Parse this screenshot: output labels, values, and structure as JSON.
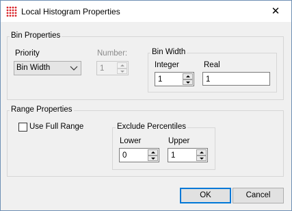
{
  "window": {
    "title": "Local Histogram Properties",
    "app_icon": "grid-dots-icon",
    "close_glyph": "✕"
  },
  "bin_properties": {
    "legend": "Bin Properties",
    "priority": {
      "label": "Priority",
      "selected": "Bin Width"
    },
    "number": {
      "label": "Number:",
      "value": "1",
      "enabled": false
    },
    "bin_width": {
      "legend": "Bin Width",
      "integer": {
        "label": "Integer",
        "value": "1"
      },
      "real": {
        "label": "Real",
        "value": "1"
      }
    }
  },
  "range_properties": {
    "legend": "Range Properties",
    "use_full_range": {
      "label": "Use Full Range",
      "checked": false
    },
    "exclude_percentiles": {
      "legend": "Exclude Percentiles",
      "lower": {
        "label": "Lower",
        "value": "0"
      },
      "upper": {
        "label": "Upper",
        "value": "1"
      }
    }
  },
  "buttons": {
    "ok": "OK",
    "cancel": "Cancel"
  },
  "colors": {
    "accent": "#0078d7",
    "icon_red": "#d9262b"
  }
}
